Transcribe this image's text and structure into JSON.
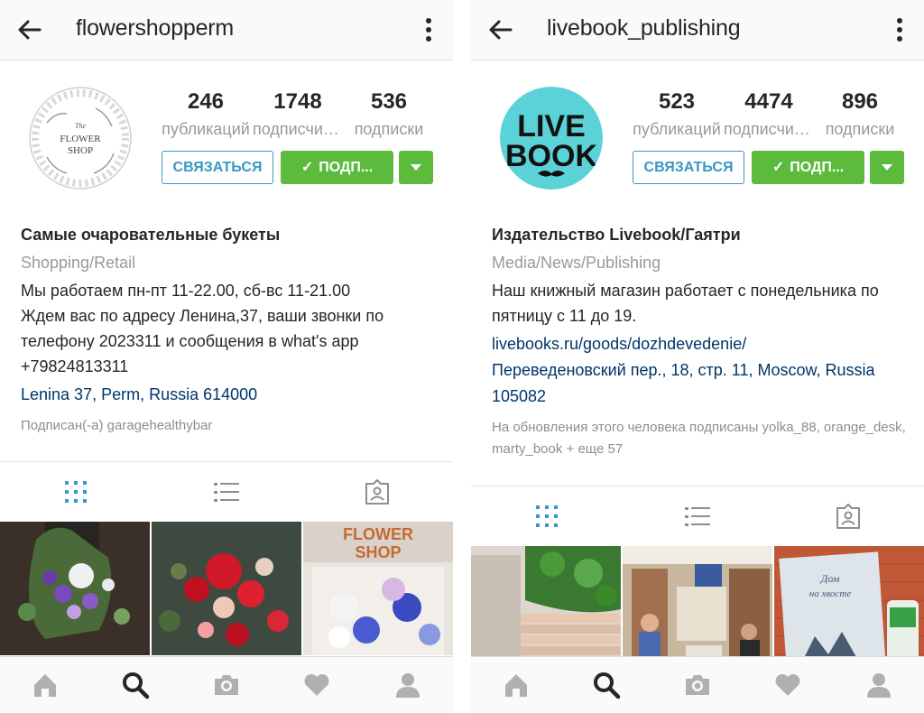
{
  "colors": {
    "accent_blue": "#3897c6",
    "follow_green": "#5cbb3c",
    "link_blue": "#003569",
    "muted": "#999999"
  },
  "left": {
    "username": "flowershopperm",
    "avatar_text": {
      "line1": "The",
      "line2": "FLOWER",
      "line3": "SHOP"
    },
    "stats": [
      {
        "value": "246",
        "label": "публикаций"
      },
      {
        "value": "1748",
        "label": "подписчиков"
      },
      {
        "value": "536",
        "label": "подписки"
      }
    ],
    "buttons": {
      "contact": "СВЯЗАТЬСЯ",
      "follow": "ПОДП..."
    },
    "bio": {
      "name": "Самые очаровательные букеты",
      "category": "Shopping/Retail",
      "description": "Мы работаем пн-пт 11-22.00, сб-вс 11-21.00\nЖдем вас по адресу Ленина,37, ваши звонки по телефону 2023311 и сообщения в what's app\n+79824813311",
      "address": "Lenina 37, Perm, Russia 614000",
      "followed_by": "Подписан(-а) garagehealthybar"
    }
  },
  "right": {
    "username": "livebook_publishing",
    "avatar_text": {
      "line1": "LIVE",
      "line2": "BOOK"
    },
    "stats": [
      {
        "value": "523",
        "label": "публикаций"
      },
      {
        "value": "4474",
        "label": "подписчиков"
      },
      {
        "value": "896",
        "label": "подписки"
      }
    ],
    "buttons": {
      "contact": "СВЯЗАТЬСЯ",
      "follow": "ПОДП..."
    },
    "bio": {
      "name": "Издательство Livebook/Гаятри",
      "category": "Media/News/Publishing",
      "description": "Наш книжный магазин работает с понедельника по пятницу с 11 до 19.",
      "website": "livebooks.ru/goods/dozhdevedenie/",
      "address": "Переведеновский пер., 18, стр. 11, Moscow, Russia 105082",
      "followed_by": "На обновления этого человека подписаны yolka_88, orange_desk, marty_book + еще 57"
    }
  },
  "tabs": [
    "grid-view",
    "list-view",
    "tagged-photos"
  ],
  "bottom_nav": [
    "home",
    "search",
    "camera",
    "activity",
    "profile"
  ]
}
